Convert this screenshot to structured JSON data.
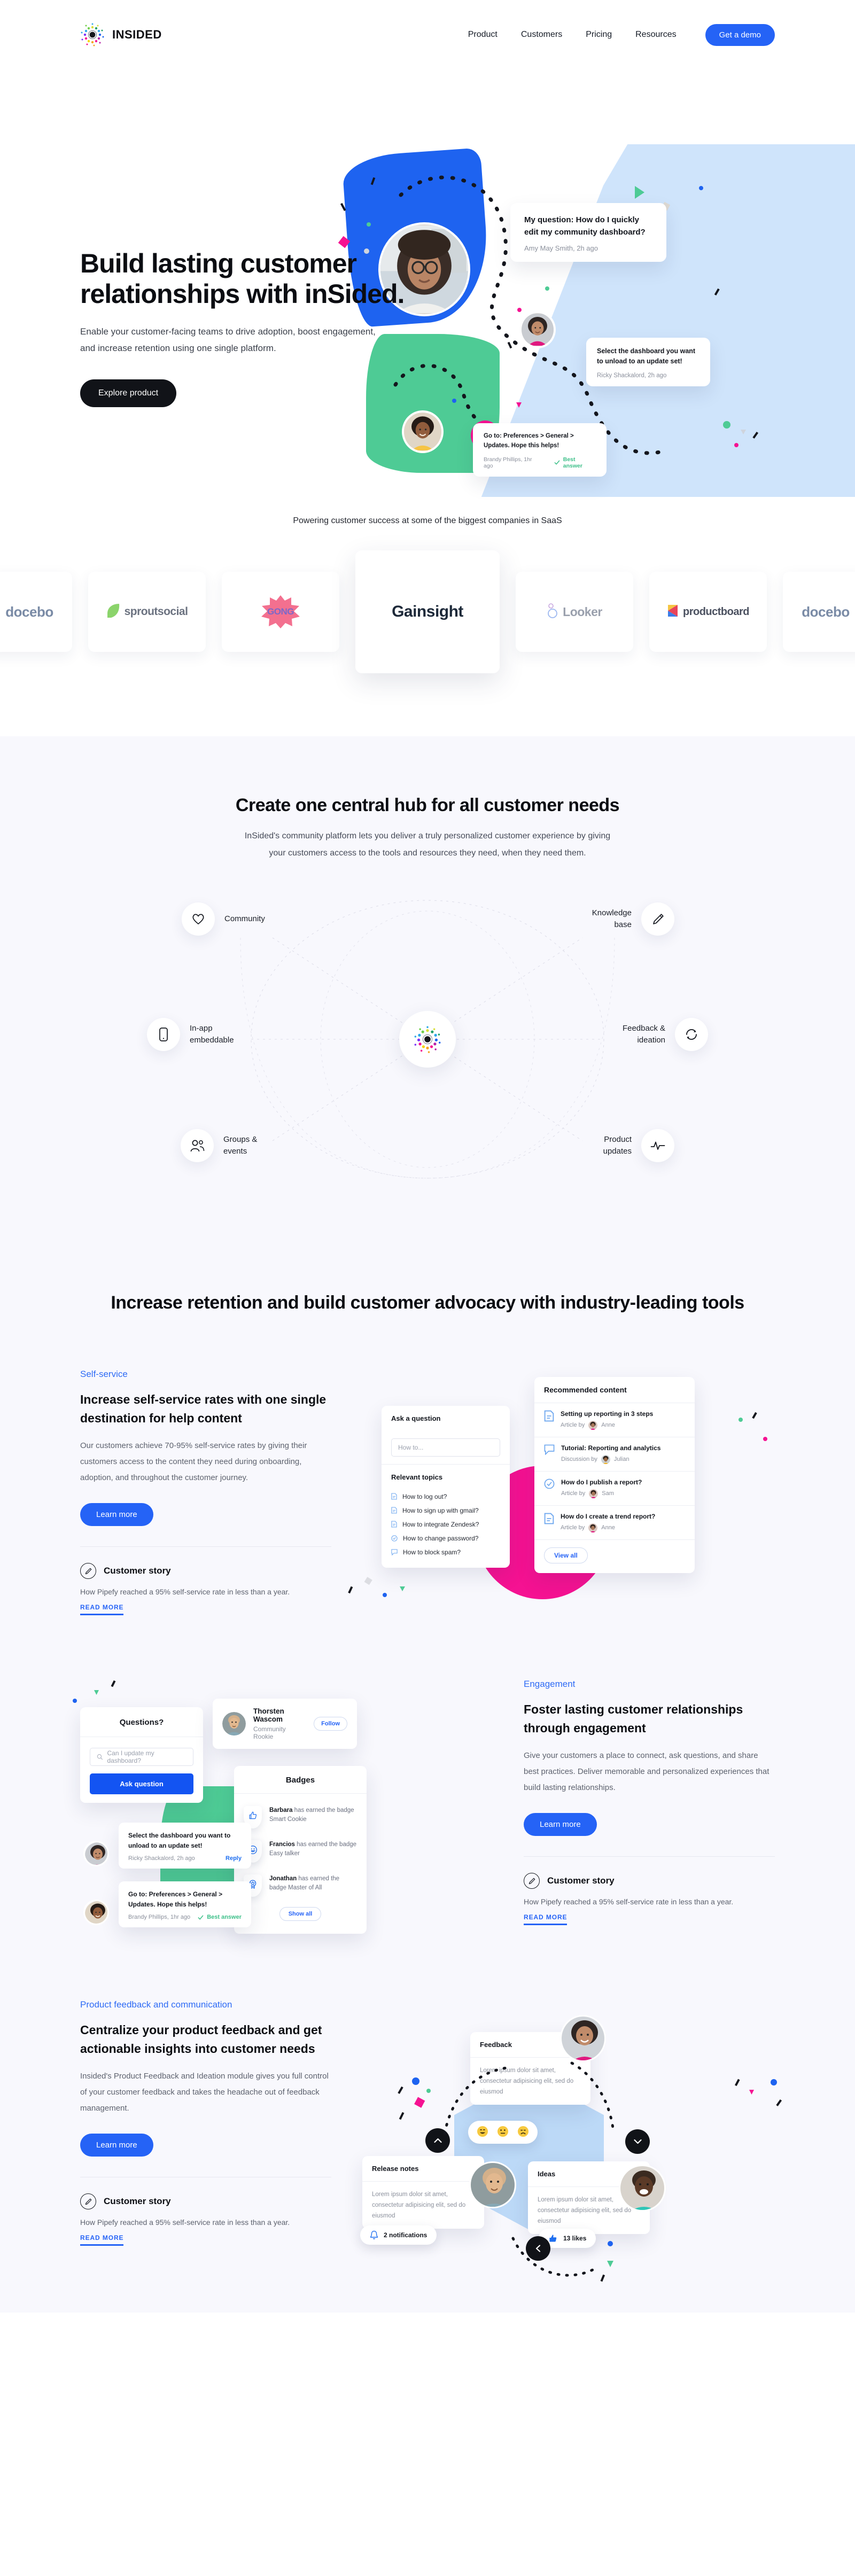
{
  "header": {
    "brand_name": "INSIDED",
    "nav": [
      {
        "label": "Product"
      },
      {
        "label": "Customers"
      },
      {
        "label": "Pricing"
      },
      {
        "label": "Resources"
      }
    ],
    "cta": "Get a demo"
  },
  "hero": {
    "title": "Build lasting customer relationships with inSided.",
    "subtitle": "Enable your customer-facing teams to drive adoption, boost engagement, and increase retention using one single platform.",
    "cta": "Explore product",
    "bubbles": [
      {
        "text": "My question: How do I quickly edit my community dashboard?",
        "meta": "Amy May Smith, 2h ago",
        "badge": ""
      },
      {
        "text": "Select the dashboard you want to unload to an update set!",
        "meta": "Ricky Shackalord, 2h ago",
        "badge": ""
      },
      {
        "text": "Go to: Preferences > General > Updates. Hope this helps!",
        "meta": "Brandy Phillips, 1hr ago",
        "badge": "Best answer"
      }
    ]
  },
  "logos": {
    "title": "Powering customer success at some of the biggest companies in SaaS",
    "items": [
      {
        "name": "docebo",
        "color": "#7a8ba6"
      },
      {
        "name": "sproutsocial",
        "color": "#6b7280"
      },
      {
        "name": "GONG",
        "color": "#7b68c8"
      },
      {
        "name": "Gainsight",
        "color": "#1d2939"
      },
      {
        "name": "Looker",
        "color": "#9aa0ad"
      },
      {
        "name": "productboard",
        "color": "#4b5160"
      },
      {
        "name": "docebo",
        "color": "#7a8ba6"
      }
    ],
    "active_index": 3
  },
  "hub": {
    "heading": "Create one central hub for all customer needs",
    "subheading": "InSided's community platform lets you deliver a truly personalized customer experience by giving your customers access to the tools and resources they need, when they need them.",
    "nodes": [
      {
        "label": "Community",
        "icon": "heart-icon",
        "side": "left"
      },
      {
        "label": "In-app embeddable",
        "icon": "mobile-icon",
        "side": "left"
      },
      {
        "label": "Groups & events",
        "icon": "users-icon",
        "side": "left"
      },
      {
        "label": "Knowledge base",
        "icon": "pencil-icon",
        "side": "right"
      },
      {
        "label": "Feedback & ideation",
        "icon": "refresh-icon",
        "side": "right"
      },
      {
        "label": "Product updates",
        "icon": "pulse-icon",
        "side": "right"
      }
    ]
  },
  "features": {
    "heading": "Increase retention and build customer advocacy with industry-leading tools",
    "blocks": [
      {
        "eyebrow": "Self-service",
        "title": "Increase self-service rates with one single destination for help content",
        "body": "Our customers achieve 70-95% self-service rates by giving their customers access to the content they need during onboarding, adoption, and throughout the customer journey.",
        "cta": "Learn more",
        "story_title": "Customer story",
        "story_body": "How Pipefy reached a 95% self-service rate in less than a year.",
        "story_link": "READ MORE"
      },
      {
        "eyebrow": "Engagement",
        "title": "Foster lasting customer relationships through engagement",
        "body": "Give your customers a place to connect, ask questions, and share best practices. Deliver memorable and personalized experiences that build lasting relationships.",
        "cta": "Learn more",
        "story_title": "Customer story",
        "story_body": "How Pipefy reached a 95% self-service rate in less than a year.",
        "story_link": "READ MORE"
      },
      {
        "eyebrow": "Product feedback and communication",
        "title": "Centralize your product feedback and get actionable insights into customer needs",
        "body": "Insided's Product Feedback and Ideation module gives you full control of your customer feedback and takes the headache out of feedback management.",
        "cta": "Learn more",
        "story_title": "Customer story",
        "story_body": "How Pipefy reached a 95% self-service rate in less than a year.",
        "story_link": "READ MORE"
      }
    ]
  },
  "art_selfservice": {
    "ask_title": "Ask a question",
    "ask_placeholder": "How to...",
    "topics_title": "Relevant topics",
    "topics": [
      {
        "label": "How to log out?",
        "icon": "doc-icon"
      },
      {
        "label": "How to sign up with gmail?",
        "icon": "doc-icon"
      },
      {
        "label": "How to integrate Zendesk?",
        "icon": "doc-icon"
      },
      {
        "label": "How to change password?",
        "icon": "check-icon"
      },
      {
        "label": "How to block spam?",
        "icon": "chat-icon"
      }
    ],
    "rec_title": "Recommended content",
    "rec_items": [
      {
        "title": "Setting up reporting in 3 steps",
        "meta": "Article by",
        "author": "Anne",
        "icon": "doc-icon"
      },
      {
        "title": "Tutorial: Reporting and analytics",
        "meta": "Discussion by",
        "author": "Julian",
        "icon": "chat-icon"
      },
      {
        "title": "How do I publish a report?",
        "meta": "Article by",
        "author": "Sam",
        "icon": "check-icon"
      },
      {
        "title": "How do I create a trend report?",
        "meta": "Article by",
        "author": "Anne",
        "icon": "doc-icon"
      }
    ],
    "view_all": "View all"
  },
  "art_engagement": {
    "q_title": "Questions?",
    "q_placeholder": "Can I update my dashboard?",
    "q_button": "Ask question",
    "profile_name": "Thorsten Wascom",
    "profile_rank": "Community Rookie",
    "follow": "Follow",
    "badges_title": "Badges",
    "badges": [
      {
        "name": "Barbara",
        "text": "has earned the badge Smart Cookie",
        "icon": "thumbs-up-icon"
      },
      {
        "name": "Francios",
        "text": "has earned the badge Easy talker",
        "icon": "smiley-icon"
      },
      {
        "name": "Jonathan",
        "text": "has earned the badge Master of All",
        "icon": "star-badge-icon"
      }
    ],
    "show_all": "Show all",
    "reply1_text": "Select the dashboard you want to unload to an update set!",
    "reply1_meta": "Ricky Shackalord, 2h ago",
    "reply1_action": "Reply",
    "reply2_text": "Go to: Preferences > General > Updates. Hope this helps!",
    "reply2_meta": "Brandy Phillips, 1hr ago",
    "reply2_badge": "Best answer"
  },
  "art_feedback": {
    "cards": [
      {
        "title": "Feedback",
        "body": "Lorem ipsum dolor sit amet, consectetur adipisicing elit, sed do eiusmod"
      },
      {
        "title": "Release notes",
        "body": "Lorem ipsum dolor sit amet, consectetur adipisicing elit, sed do eiusmod"
      },
      {
        "title": "Ideas",
        "body": "Lorem ipsum dolor sit amet, consectetur adipisicing elit, sed do eiusmod"
      }
    ],
    "notifications": "2 notifications",
    "likes": "13 likes",
    "emojis": [
      "happy-face",
      "neutral-face",
      "sad-face"
    ]
  },
  "colors": {
    "accent_blue": "#2563f6",
    "hero_blue": "#1e63f0",
    "green": "#4ecb95",
    "pink": "#f51292",
    "light_blue": "#cfe4fb",
    "dark": "#111318",
    "section_bg": "#f8f8fd"
  }
}
